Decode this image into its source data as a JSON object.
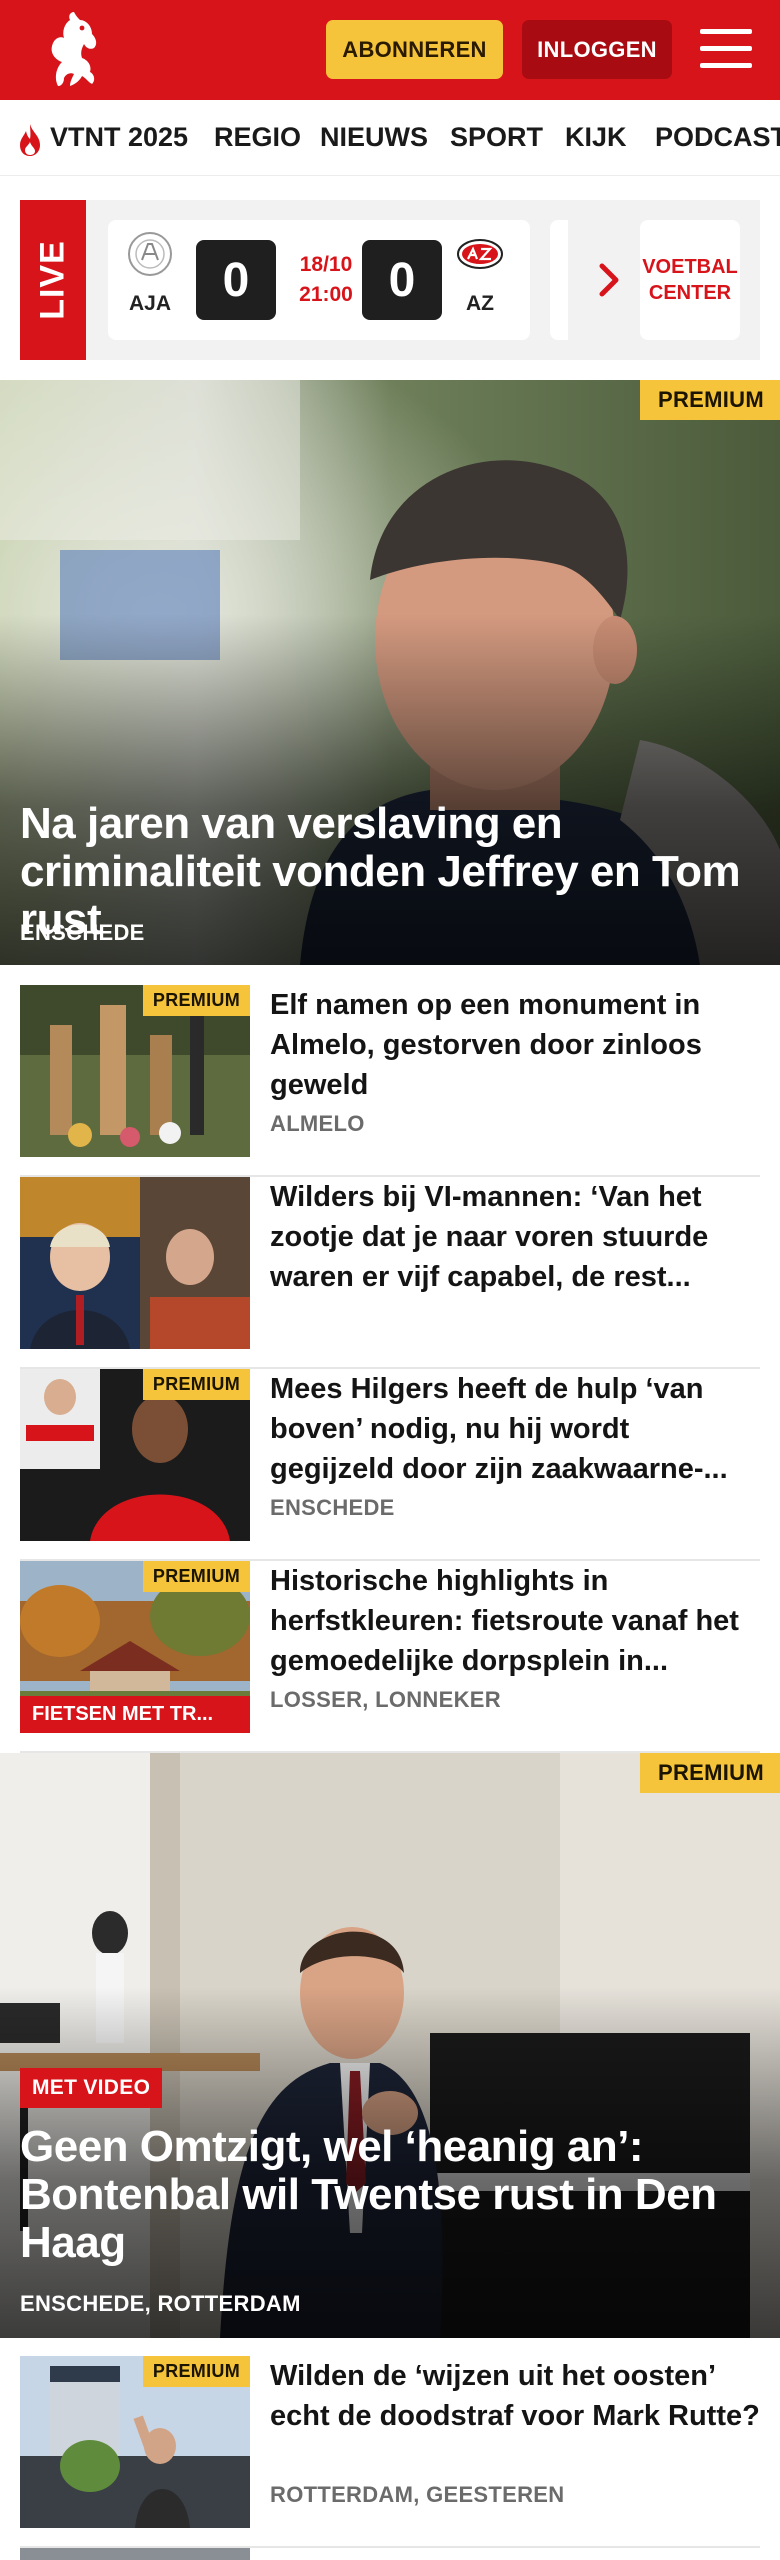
{
  "header": {
    "subscribe_label": "ABONNEREN",
    "login_label": "INLOGGEN",
    "brand_color": "#d7141a",
    "accent_color": "#f5c43a"
  },
  "nav": {
    "items": [
      "VTNT 2025",
      "REGIO",
      "NIEUWS",
      "SPORT",
      "KIJK",
      "PODCAST"
    ]
  },
  "live": {
    "label": "LIVE",
    "match": {
      "home_team": "AJA",
      "away_team": "AZ",
      "home_score": "0",
      "away_score": "0",
      "date": "18/10",
      "time": "21:00"
    },
    "football_center_label": "VOETBAL CENTER"
  },
  "hero1": {
    "badge": "PREMIUM",
    "title": "Na jaren van verslaving en criminaliteit vonden Jeffrey en Tom rust",
    "location": "ENSCHEDE"
  },
  "articles1": [
    {
      "badge": "PREMIUM",
      "title": "Elf namen op een monument in Almelo, gestorven door zinloos geweld",
      "location": "ALMELO"
    },
    {
      "title": "Wilders bij VI-mannen: ‘Van het zootje dat je naar voren stuurde waren er vijf capabel, de rest...",
      "location": ""
    },
    {
      "badge": "PREMIUM",
      "title": "Mees Hilgers heeft de hulp ‘van boven’ nodig, nu hij wordt gegijzeld door zijn zaakwaarne-...",
      "location": "ENSCHEDE"
    },
    {
      "badge": "PREMIUM",
      "tag": "FIETSEN MET TR...",
      "title": "Historische highlights in herfstkleuren: fietsroute vanaf het gemoedelijke dorpsplein in...",
      "location": "LOSSER, LONNEKER"
    }
  ],
  "hero2": {
    "badge": "PREMIUM",
    "video_tag": "MET VIDEO",
    "title": "Geen Omtzigt, wel ‘heanig an’: Bontenbal wil Twentse rust in Den Haag",
    "location": "ENSCHEDE, ROTTERDAM"
  },
  "articles2": [
    {
      "badge": "PREMIUM",
      "title": "Wilden de ‘wijzen uit het oosten’ echt de doodstraf voor Mark Rutte?",
      "location": "ROTTERDAM, GEESTEREN"
    }
  ]
}
